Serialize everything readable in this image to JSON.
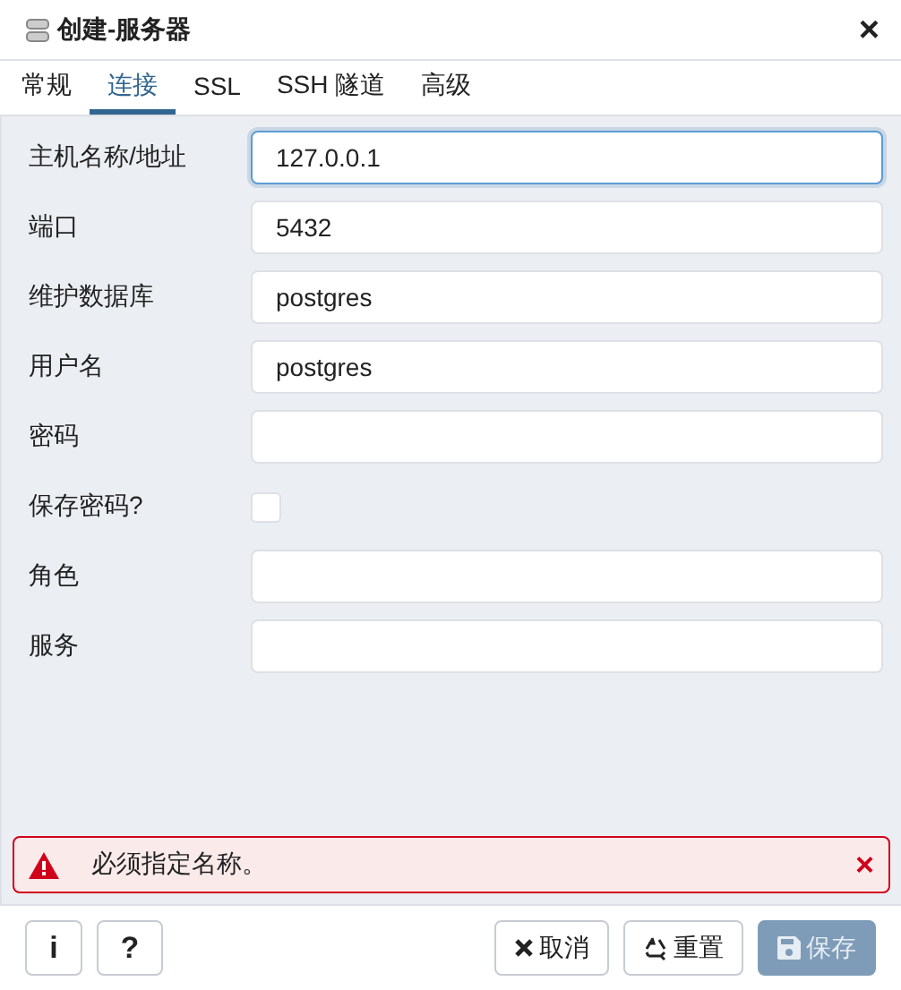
{
  "window": {
    "title": "创建-服务器",
    "close": "×"
  },
  "tabs": [
    {
      "label": "常规",
      "selected": false
    },
    {
      "label": "连接",
      "selected": true
    },
    {
      "label": "SSL",
      "selected": false
    },
    {
      "label": "SSH 隧道",
      "selected": false
    },
    {
      "label": "高级",
      "selected": false
    }
  ],
  "fields": [
    {
      "kind": "text",
      "label": "主机名称/地址",
      "value": "127.0.0.1",
      "focused": true
    },
    {
      "kind": "text",
      "label": "端口",
      "value": "5432",
      "focused": false
    },
    {
      "kind": "text",
      "label": "维护数据库",
      "value": "postgres",
      "focused": false
    },
    {
      "kind": "text",
      "label": "用户名",
      "value": "postgres",
      "focused": false
    },
    {
      "kind": "text",
      "label": "密码",
      "focused": false
    },
    {
      "kind": "checkbox",
      "label": "保存密码?",
      "checked": false
    },
    {
      "kind": "text",
      "label": "角色",
      "focused": false
    },
    {
      "kind": "text",
      "label": "服务",
      "focused": false
    }
  ],
  "alert": {
    "message": "必须指定名称。",
    "close": "×"
  },
  "footer": {
    "info": "i",
    "help": "?",
    "buttons": [
      {
        "kind": "cancel",
        "label": "取消",
        "disabled": false
      },
      {
        "kind": "reset",
        "label": "重置",
        "disabled": false
      },
      {
        "kind": "save",
        "label": "保存",
        "disabled": true
      }
    ]
  }
}
